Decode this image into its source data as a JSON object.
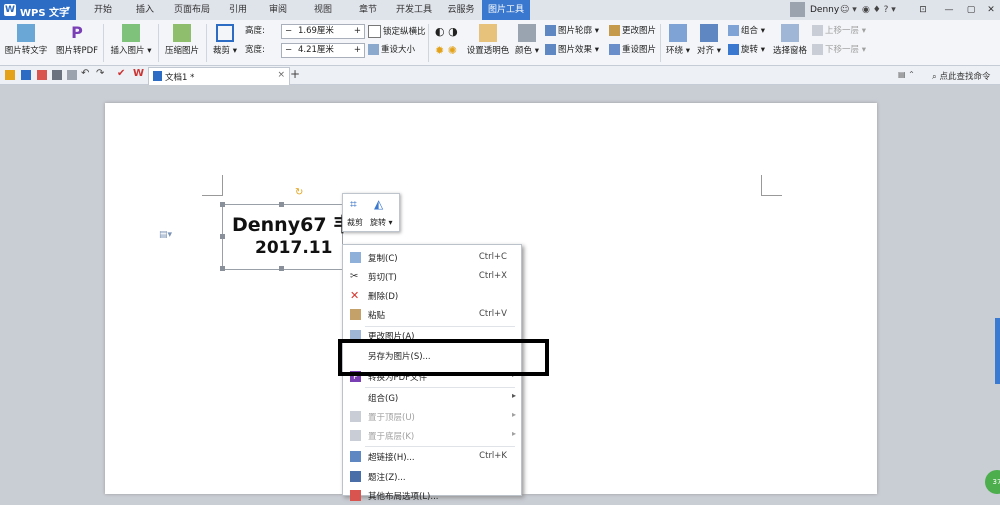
{
  "app": {
    "name": "WPS 文字"
  },
  "tabs": [
    "开始",
    "插入",
    "页面布局",
    "引用",
    "审阅",
    "视图",
    "章节",
    "开发工具",
    "云服务",
    "图片工具"
  ],
  "active_tab": "图片工具",
  "user": {
    "name": "Denny"
  },
  "ribbon": {
    "img_to_text": "图片转文字",
    "img_to_pdf": "图片转PDF",
    "insert_image": "插入图片",
    "compress": "压缩图片",
    "crop": "裁剪",
    "height_label": "高度:",
    "height_value": "1.69厘米",
    "width_label": "宽度:",
    "width_value": "4.21厘米",
    "lock_ratio": "锁定纵横比",
    "reset_size": "重设大小",
    "set_transparent": "设置透明色",
    "color": "颜色",
    "outline": "图片轮廓",
    "effect": "图片效果",
    "change_image": "更改图片",
    "reset_image": "重设图片",
    "wrap": "环绕",
    "align": "对齐",
    "group": "组合",
    "rotate": "旋转",
    "select_pane": "选择窗格",
    "bring_forward": "上移一层",
    "send_backward": "下移一层"
  },
  "quickbar": {
    "doc_tab": "文档1 *",
    "find_cmd": "点此查找命令"
  },
  "document": {
    "image_line1": "Denny67  韦...",
    "image_line2": "2017.11"
  },
  "mini_toolbar": {
    "crop": "裁剪",
    "rotate": "旋转"
  },
  "context_menu": {
    "items": [
      {
        "label": "复制(C)",
        "shortcut": "Ctrl+C"
      },
      {
        "label": "剪切(T)",
        "shortcut": "Ctrl+X"
      },
      {
        "label": "删除(D)",
        "shortcut": ""
      },
      {
        "label": "粘贴",
        "shortcut": "Ctrl+V"
      },
      {
        "label": "更改图片(A)",
        "shortcut": ""
      },
      {
        "label": "另存为图片(S)...",
        "shortcut": ""
      },
      {
        "label": "转换为PDF文件",
        "shortcut": ""
      },
      {
        "label": "组合(G)",
        "shortcut": ""
      },
      {
        "label": "置于顶层(U)",
        "shortcut": ""
      },
      {
        "label": "置于底层(K)",
        "shortcut": ""
      },
      {
        "label": "超链接(H)...",
        "shortcut": "Ctrl+K"
      },
      {
        "label": "题注(Z)...",
        "shortcut": ""
      },
      {
        "label": "其他布局选项(L)...",
        "shortcut": ""
      }
    ]
  },
  "colors": {
    "accent": "#3a78cf",
    "wps_blue": "#2d6cc4",
    "highlight_box": "#000000"
  },
  "badge": {
    "text": "37"
  }
}
